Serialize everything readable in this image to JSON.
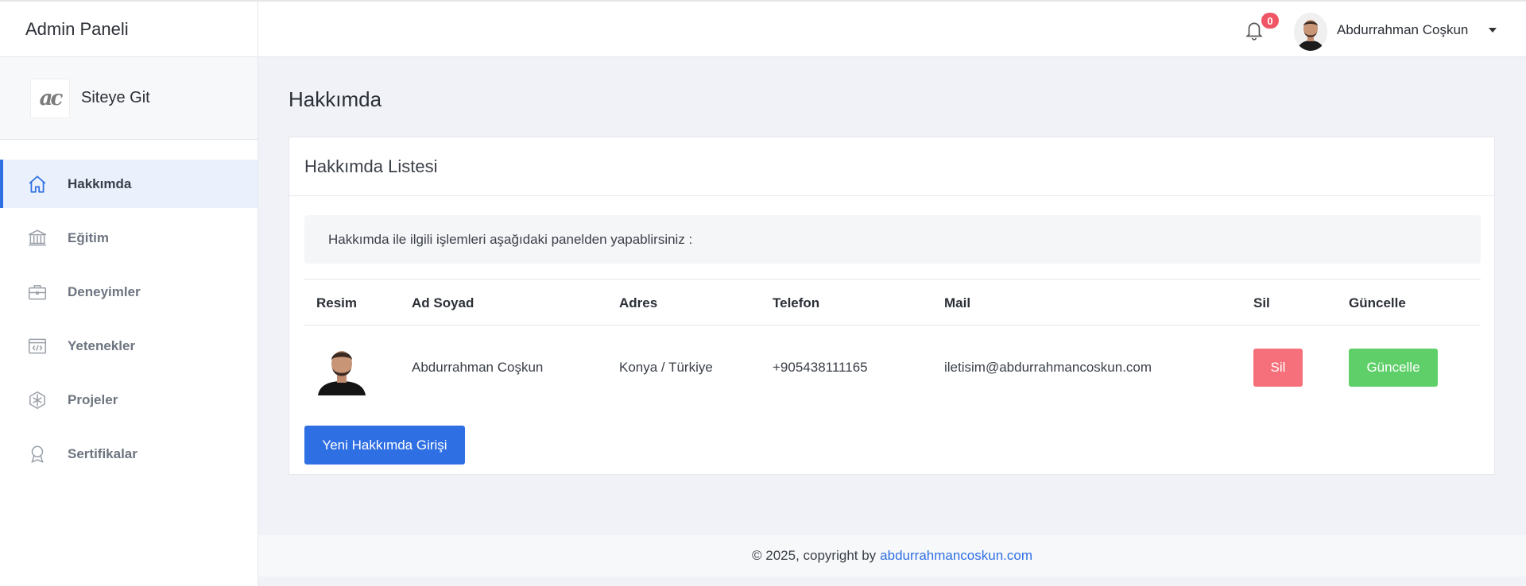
{
  "app": {
    "brand_title": "Admin Paneli",
    "site_link_label": "Siteye Git",
    "logo_text": "ac"
  },
  "sidebar": {
    "items": [
      {
        "label": "Hakkımda",
        "icon": "home-icon",
        "active": true
      },
      {
        "label": "Eğitim",
        "icon": "bank-icon",
        "active": false
      },
      {
        "label": "Deneyimler",
        "icon": "briefcase-icon",
        "active": false
      },
      {
        "label": "Yetenekler",
        "icon": "code-window-icon",
        "active": false
      },
      {
        "label": "Projeler",
        "icon": "projects-icon",
        "active": false
      },
      {
        "label": "Sertifikalar",
        "icon": "award-icon",
        "active": false
      }
    ]
  },
  "header": {
    "notification_count": "0",
    "user_name": "Abdurrahman Coşkun"
  },
  "page": {
    "title": "Hakkımda",
    "card_title": "Hakkımda Listesi",
    "info_text": "Hakkımda ile ilgili işlemleri aşağıdaki panelden yapablirsiniz :",
    "new_button_label": "Yeni Hakkımda Girişi"
  },
  "table": {
    "columns": [
      "Resim",
      "Ad Soyad",
      "Adres",
      "Telefon",
      "Mail",
      "Sil",
      "Güncelle"
    ],
    "rows": [
      {
        "name": "Abdurrahman Coşkun",
        "address": "Konya / Türkiye",
        "phone": "+905438111165",
        "mail": "iletisim@abdurrahmancoskun.com",
        "delete_label": "Sil",
        "update_label": "Güncelle"
      }
    ]
  },
  "footer": {
    "text": "© 2025, copyright by",
    "link": "abdurrahmancoskun.com"
  },
  "colors": {
    "accent": "#2f6fe4",
    "danger": "#f5707a",
    "success": "#5fd069",
    "badge": "#f05565"
  }
}
